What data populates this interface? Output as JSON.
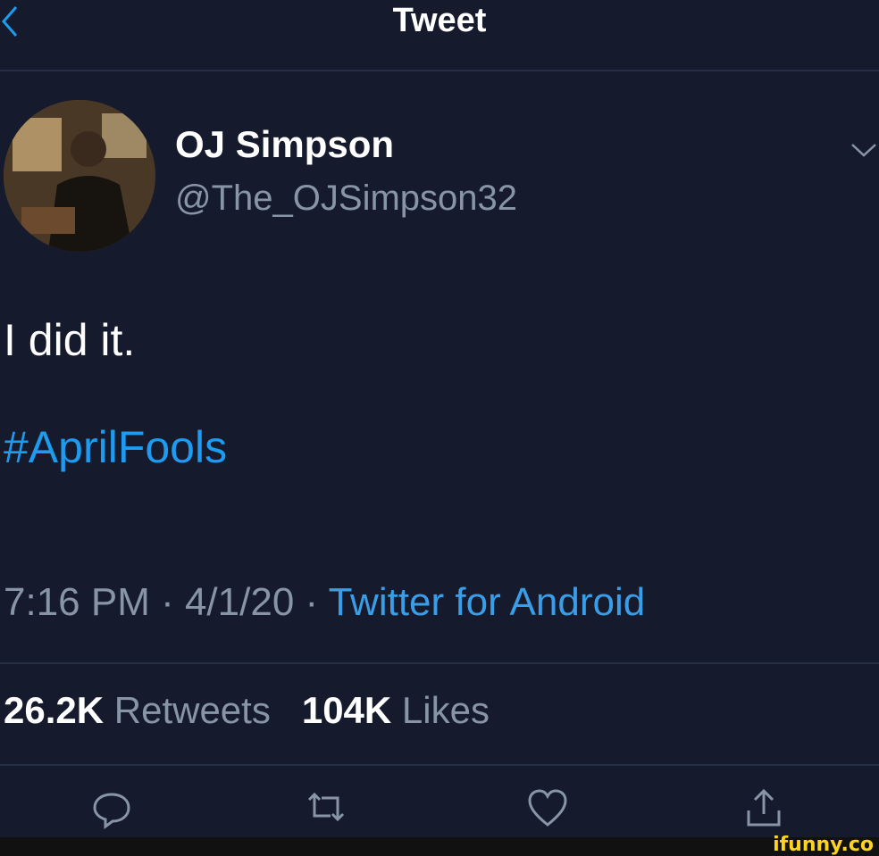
{
  "header": {
    "title": "Tweet"
  },
  "user": {
    "name": "OJ Simpson",
    "handle": "@The_OJSimpson32"
  },
  "tweet": {
    "text": "I did it.",
    "hashtag": "#AprilFools",
    "time": "7:16 PM · 4/1/20 · ",
    "source": "Twitter for Android"
  },
  "stats": {
    "retweets_count": "26.2K",
    "retweets_label": "Retweets",
    "likes_count": "104K",
    "likes_label": "Likes"
  },
  "icons": [
    "back-chevron-icon",
    "chevron-down-icon",
    "reply-icon",
    "retweet-icon",
    "like-icon",
    "share-icon"
  ],
  "watermark": "ifunny.co",
  "colors": {
    "background": "#151b2c",
    "accent": "#1d9bf0",
    "secondary_text": "#8795a6"
  }
}
